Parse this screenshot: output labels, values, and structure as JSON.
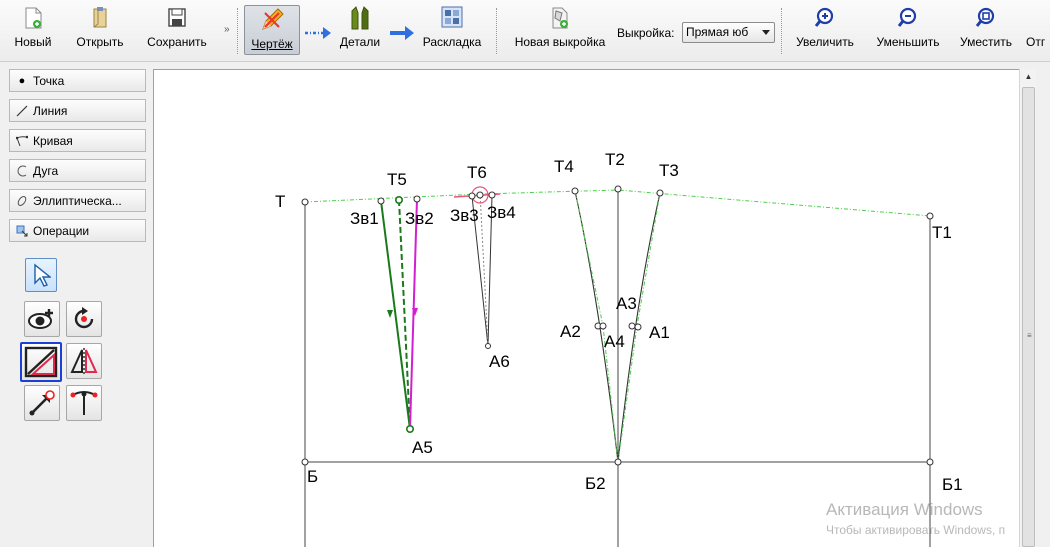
{
  "toolbar": {
    "new_label": "Новый",
    "open_label": "Открыть",
    "save_label": "Сохранить",
    "draft_label": "Чертёж",
    "details_label": "Детали",
    "layout_label": "Раскладка",
    "new_pattern_label": "Новая выкройка",
    "pattern_label": "Выкройка:",
    "pattern_value": "Прямая юб",
    "zoom_in_label": "Увеличить",
    "zoom_out_label": "Уменьшить",
    "fit_label": "Уместить",
    "cut_label": "Отг",
    "overflow_chevron": "»"
  },
  "tool_groups": [
    {
      "label": "Точка",
      "icon": "point-icon"
    },
    {
      "label": "Линия",
      "icon": "line-icon"
    },
    {
      "label": "Кривая",
      "icon": "curve-icon"
    },
    {
      "label": "Дуга",
      "icon": "arc-icon"
    },
    {
      "label": "Эллиптическа...",
      "icon": "elliptic-arc-icon"
    },
    {
      "label": "Операции",
      "icon": "operations-icon"
    }
  ],
  "point_labels": {
    "T": "Т",
    "T1": "Т1",
    "T2": "Т2",
    "T3": "Т3",
    "T4": "Т4",
    "T5": "Т5",
    "T6": "Т6",
    "Zv1": "Зв1",
    "Zv2": "Зв2",
    "Zv3": "Зв3",
    "Zv4": "Зв4",
    "A1": "А1",
    "A2": "А2",
    "A3": "А3",
    "A4": "А4",
    "A5": "А5",
    "A6": "А6",
    "B": "Б",
    "B1": "Б1",
    "B2": "Б2"
  },
  "watermark": {
    "line1": "Активация Windows",
    "line2": "Чтобы активировать Windows, п"
  },
  "colors": {
    "accent_blue": "#1c3fd8",
    "dart_green": "#1a7a1a",
    "dart_magenta": "#d21fd2",
    "guide_green": "#4ccf4c",
    "selection_pink": "#e8557a"
  }
}
